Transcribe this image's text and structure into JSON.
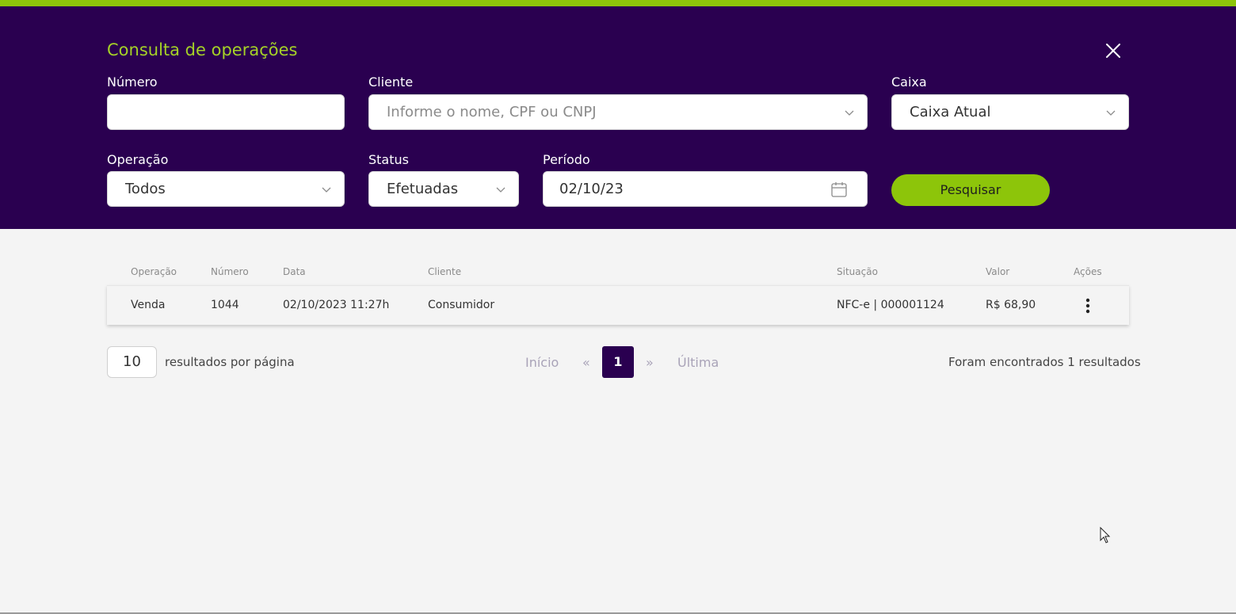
{
  "header": {
    "title": "Consulta de operações"
  },
  "form": {
    "numero": {
      "label": "Número",
      "value": ""
    },
    "cliente": {
      "label": "Cliente",
      "placeholder": "Informe o nome, CPF ou CNPJ"
    },
    "caixa": {
      "label": "Caixa",
      "value": "Caixa Atual"
    },
    "operacao": {
      "label": "Operação",
      "value": "Todos"
    },
    "status": {
      "label": "Status",
      "value": "Efetuadas"
    },
    "periodo": {
      "label": "Período",
      "value": "02/10/23"
    },
    "search_button": "Pesquisar"
  },
  "table": {
    "headers": {
      "operacao": "Operação",
      "numero": "Número",
      "data": "Data",
      "cliente": "Cliente",
      "situacao": "Situação",
      "valor": "Valor",
      "acoes": "Ações"
    },
    "rows": [
      {
        "operacao": "Venda",
        "numero": "1044",
        "data": "02/10/2023 11:27h",
        "cliente": "Consumidor",
        "situacao": "NFC-e | 000001124",
        "valor": "R$  68,90"
      }
    ]
  },
  "pagination": {
    "per_page": "10",
    "per_page_label": "resultados por página",
    "first": "Início",
    "prev": "«",
    "current": "1",
    "next": "»",
    "last": "Última",
    "found": "Foram encontrados 1 resultados"
  },
  "colors": {
    "header_bg": "#2a0050",
    "accent": "#8dc50a",
    "title": "#a5d127"
  },
  "icons": {
    "close": "close-icon",
    "chevron": "chevron-down-icon",
    "calendar": "calendar-icon",
    "actions": "kebab-menu-icon"
  }
}
